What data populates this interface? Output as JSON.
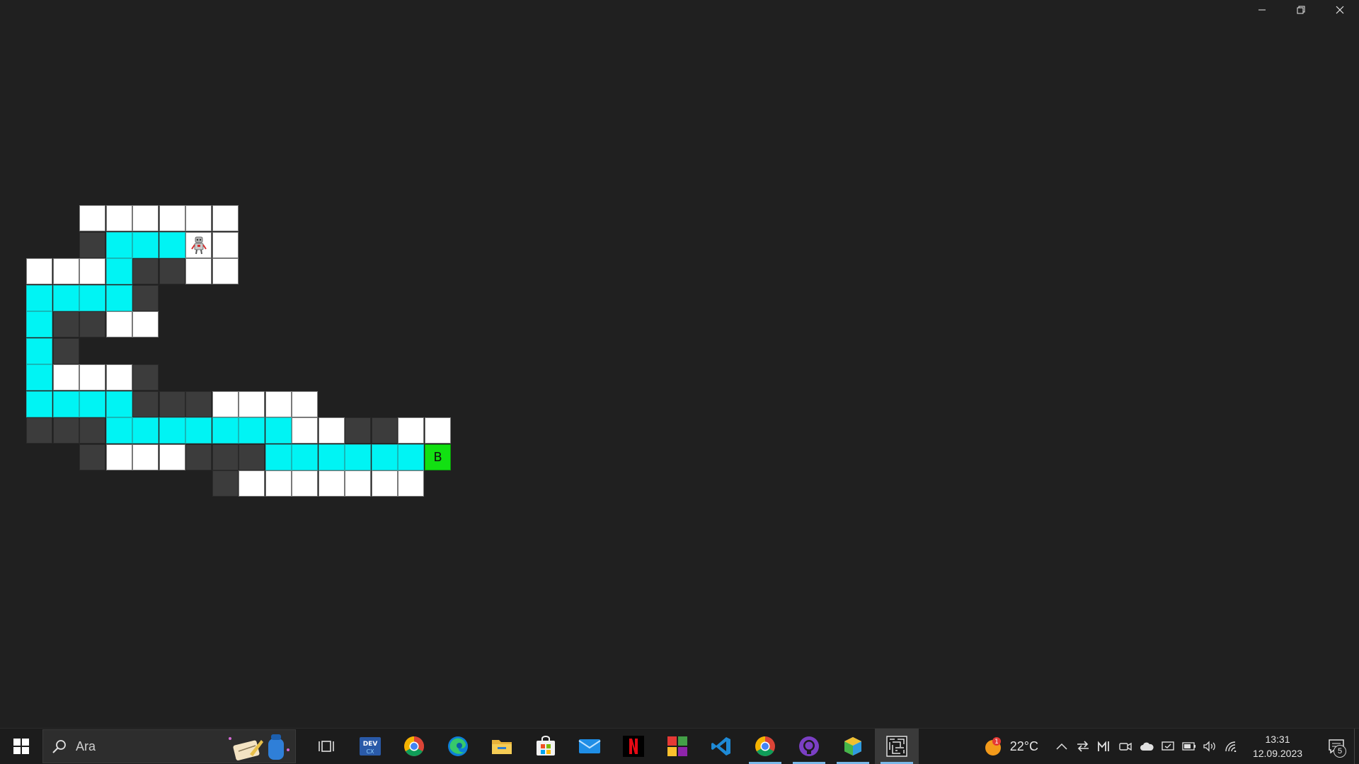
{
  "window": {
    "caption_buttons": [
      "minimize-icon",
      "restore-icon",
      "close-icon"
    ]
  },
  "maze": {
    "robot_icon": "robot-icon",
    "goal_label": "B",
    "legend_colors": {
      "open": "#ffffff",
      "path": "#00f4f4",
      "wall": "#3c3c3c",
      "goal": "#12e012"
    },
    "rows": [
      "..WWWWWW.......",
      "..DCCCRW.......",
      "WWWCDDWW.......",
      "CCCCD..........",
      "CDDWW..........",
      "CD.............",
      "CWWWD..........",
      "CCCCDDDWWWW....",
      "DDDCCCCCCCWWDDWW",
      "..DWWWDDDCCCCCCG",
      ".......DWWWWWWW"
    ]
  },
  "taskbar": {
    "search_placeholder": "Ara",
    "apps": [
      {
        "name": "task-view-icon"
      },
      {
        "name": "devcx-icon"
      },
      {
        "name": "chrome-icon"
      },
      {
        "name": "edge-icon"
      },
      {
        "name": "file-explorer-icon"
      },
      {
        "name": "microsoft-store-icon"
      },
      {
        "name": "mail-icon"
      },
      {
        "name": "netflix-icon"
      },
      {
        "name": "app-grid-icon"
      },
      {
        "name": "vscode-icon"
      },
      {
        "name": "chrome-icon-2"
      },
      {
        "name": "github-desktop-icon"
      },
      {
        "name": "cube-app-icon"
      },
      {
        "name": "maze-app-icon"
      }
    ],
    "weather_temp": "22°C",
    "weather_badge": "1",
    "time": "13:31",
    "date": "12.09.2023",
    "notification_count": "5"
  }
}
